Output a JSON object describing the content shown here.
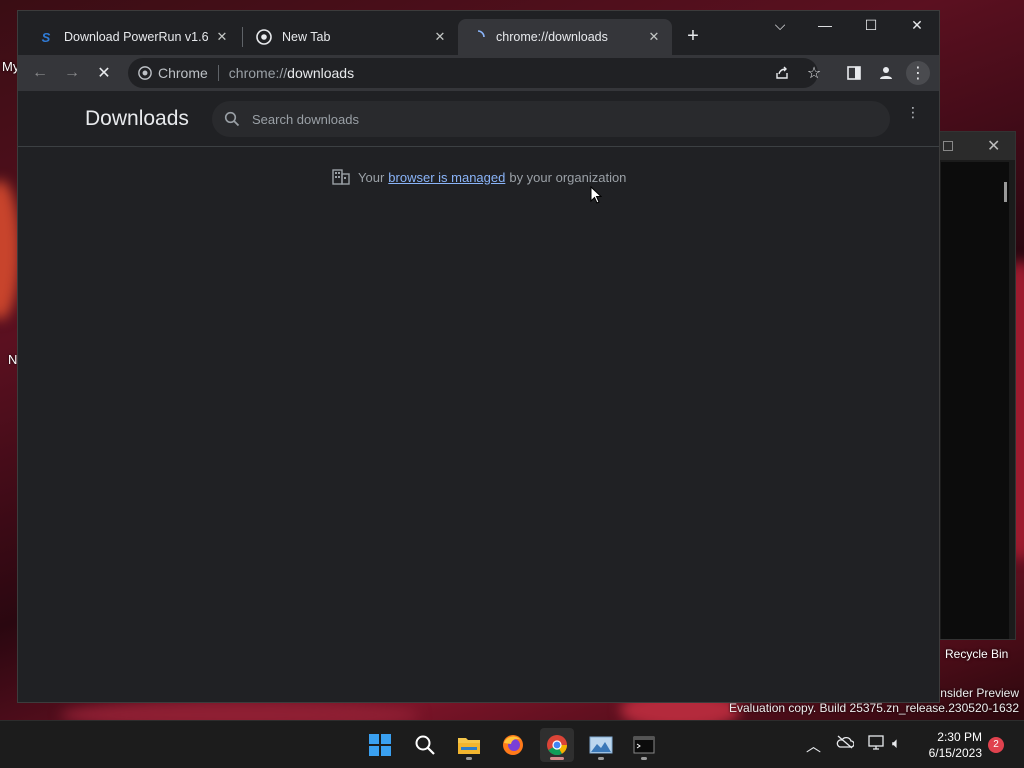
{
  "desktop": {
    "fragments": [
      "My",
      "N"
    ],
    "recycle_bin_label": "Recycle Bin",
    "insider_text": "Insider Preview",
    "build_text": "Evaluation copy. Build 25375.zn_release.230520-1632"
  },
  "browser": {
    "tabs": [
      {
        "title": "Download PowerRun v1.6",
        "favicon": "S",
        "favicon_color": "#2f7bd6"
      },
      {
        "title": "New Tab",
        "favicon": "chrome-icon"
      },
      {
        "title": "chrome://downloads",
        "favicon": "loading-spinner-icon"
      }
    ],
    "omnibox": {
      "chip": "Chrome",
      "url_scheme": "chrome://",
      "url_host": "downloads"
    }
  },
  "downloads_page": {
    "title": "Downloads",
    "search_placeholder": "Search downloads",
    "managed_prefix": "Your",
    "managed_link": "browser is managed",
    "managed_suffix": "by your organization"
  },
  "taskbar": {
    "clock_time": "2:30 PM",
    "clock_date": "6/15/2023",
    "notification_count": "2"
  },
  "colors": {
    "accent_link": "#8ab4f8",
    "page_bg": "#202124",
    "toolbar_bg": "#35363a",
    "badge": "#e0424e"
  }
}
